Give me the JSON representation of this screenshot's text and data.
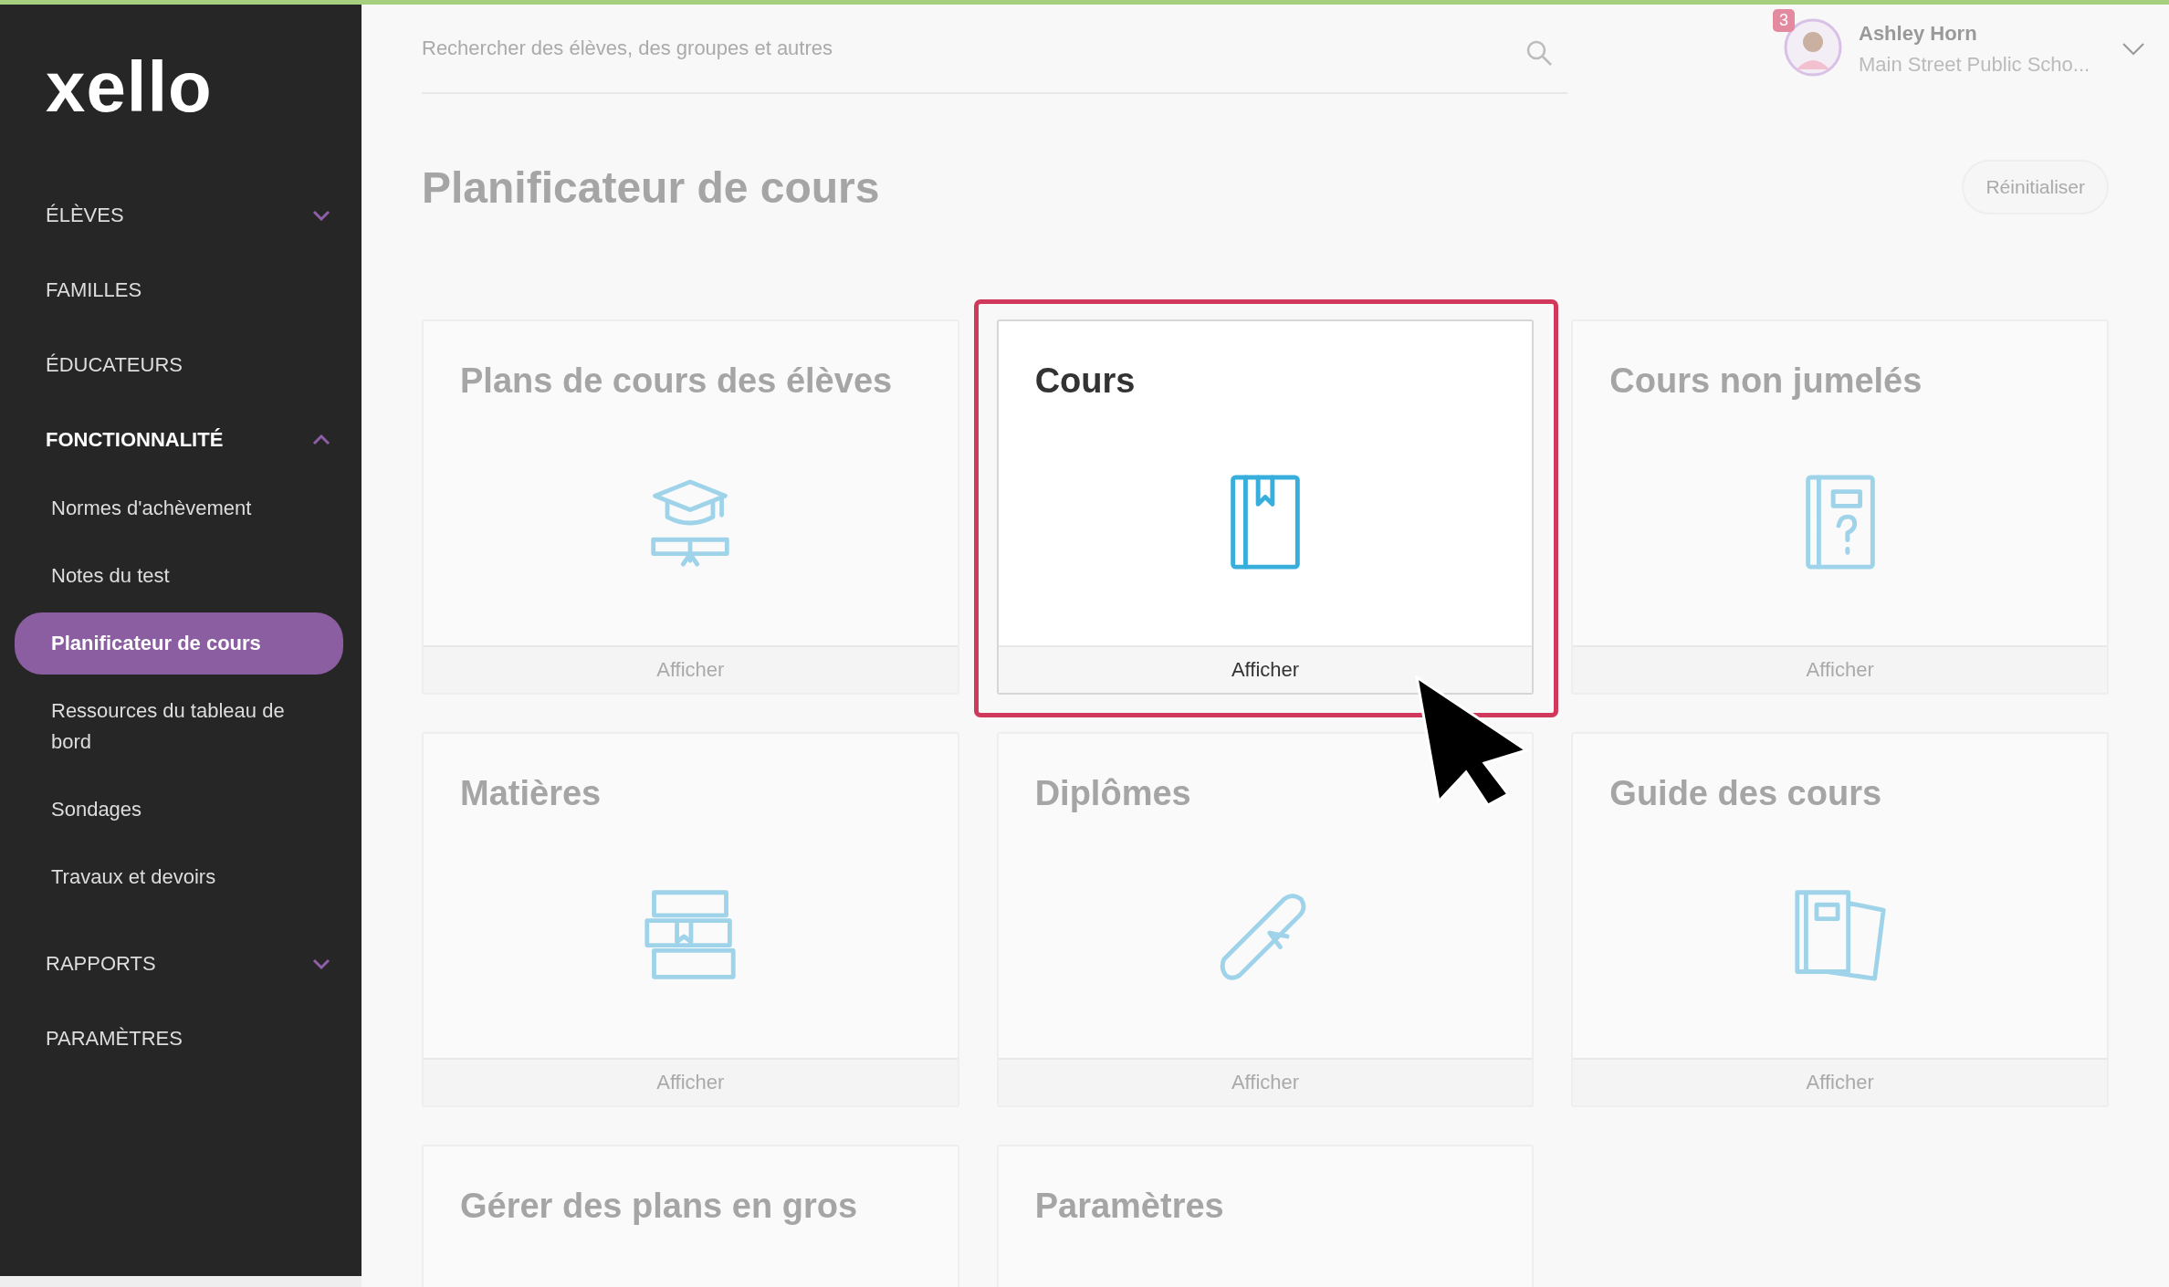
{
  "sidebar": {
    "logo": "xello",
    "items": [
      {
        "label": "ÉLÈVES",
        "kind": "group",
        "expanded": false,
        "selected": false
      },
      {
        "label": "FAMILLES",
        "kind": "link",
        "selected": false
      },
      {
        "label": "ÉDUCATEURS",
        "kind": "link",
        "selected": false
      },
      {
        "label": "FONCTIONNALITÉ",
        "kind": "group",
        "expanded": true,
        "selected": true,
        "children": [
          {
            "label": "Normes d'achèvement",
            "selected": false
          },
          {
            "label": "Notes du test",
            "selected": false
          },
          {
            "label": "Planificateur de cours",
            "selected": true
          },
          {
            "label": "Ressources du tableau de bord",
            "selected": false
          },
          {
            "label": "Sondages",
            "selected": false
          },
          {
            "label": "Travaux et devoirs",
            "selected": false
          }
        ]
      },
      {
        "label": "RAPPORTS",
        "kind": "group",
        "expanded": false,
        "selected": false
      },
      {
        "label": "PARAMÈTRES",
        "kind": "link",
        "selected": false
      }
    ]
  },
  "header": {
    "search": {
      "placeholder": "Rechercher des élèves, des groupes et autres"
    },
    "user": {
      "badge": "3",
      "name": "Ashley Horn",
      "school": "Main Street Public Scho..."
    }
  },
  "page": {
    "title": "Planificateur de cours",
    "reset_button": "Réinitialiser"
  },
  "cards": [
    {
      "title": "Plans de cours des élèves",
      "kind": "graduation",
      "action": "Afficher",
      "highlighted": false
    },
    {
      "title": "Cours",
      "kind": "book",
      "action": "Afficher",
      "highlighted": true
    },
    {
      "title": "Cours non jumelés",
      "kind": "question",
      "action": "Afficher",
      "highlighted": false
    },
    {
      "title": "Matières",
      "kind": "books",
      "action": "Afficher",
      "highlighted": false
    },
    {
      "title": "Diplômes",
      "kind": "diploma",
      "action": "Afficher",
      "highlighted": false
    },
    {
      "title": "Guide des cours",
      "kind": "guide",
      "action": "Afficher",
      "highlighted": false
    },
    {
      "title": "Gérer des plans en gros",
      "kind": "plain",
      "highlighted": false
    },
    {
      "title": "Paramètres",
      "kind": "plain",
      "highlighted": false
    }
  ]
}
